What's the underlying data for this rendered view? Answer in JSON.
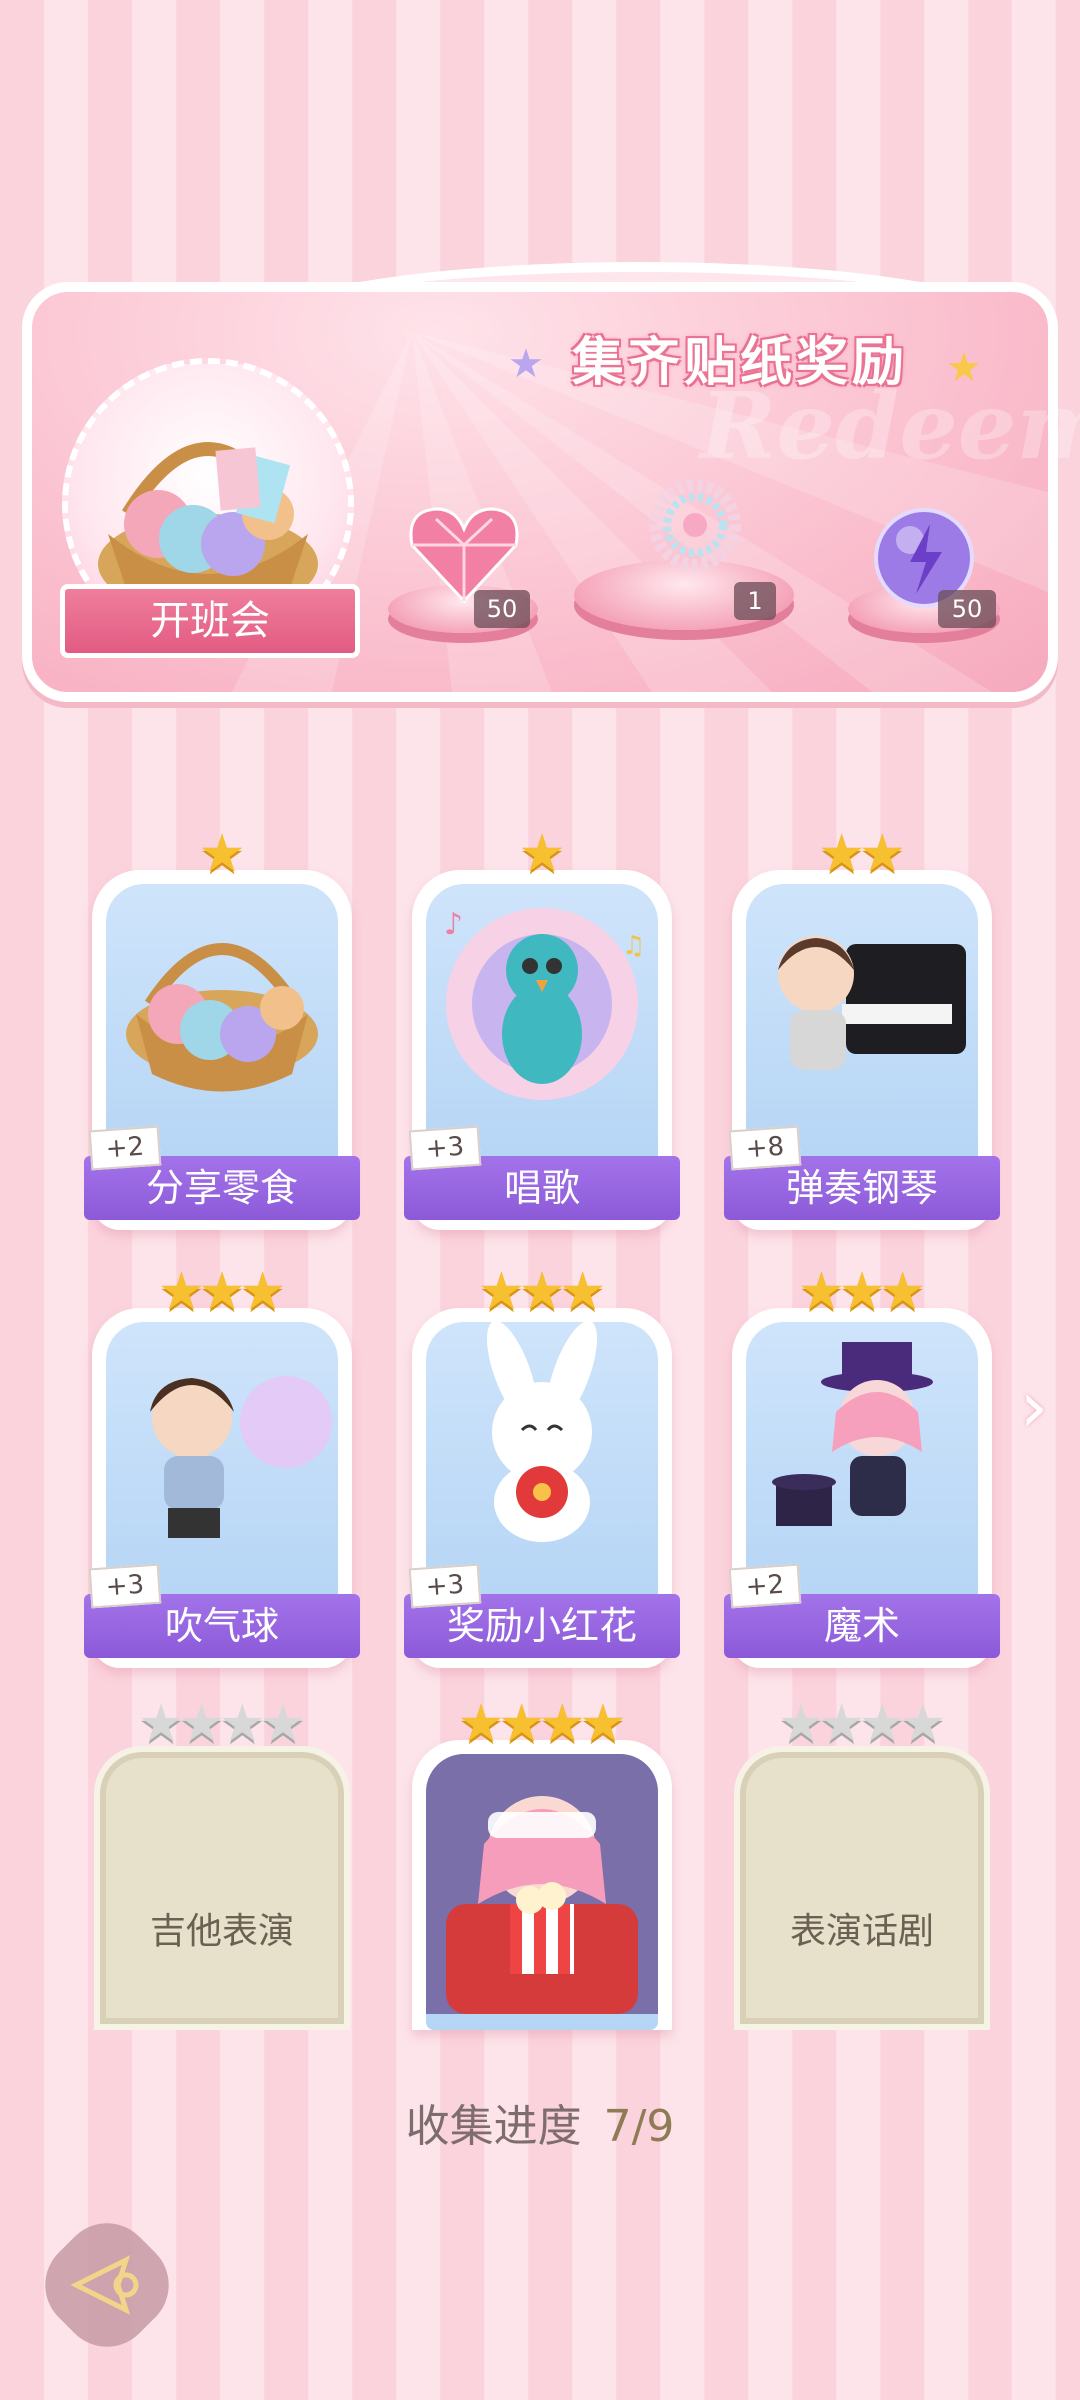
{
  "banner": {
    "title": "集齐贴纸奖励",
    "watermark": "Redeem",
    "event_name": "开班会",
    "rewards": [
      {
        "icon": "pink-heart-gem-icon",
        "count": "50"
      },
      {
        "icon": "pearl-bracelet-icon",
        "count": "1"
      },
      {
        "icon": "purple-energy-orb-icon",
        "count": "50"
      }
    ]
  },
  "stickers": [
    {
      "name": "分享零食",
      "bonus": "+2",
      "stars": 1,
      "unlocked": true,
      "icon": "snack-basket-icon"
    },
    {
      "name": "唱歌",
      "bonus": "+3",
      "stars": 1,
      "unlocked": true,
      "icon": "singing-peacock-icon"
    },
    {
      "name": "弹奏钢琴",
      "bonus": "+8",
      "stars": 2,
      "unlocked": true,
      "icon": "piano-boy-icon"
    },
    {
      "name": "吹气球",
      "bonus": "+3",
      "stars": 3,
      "unlocked": true,
      "icon": "balloon-boy-icon"
    },
    {
      "name": "奖励小红花",
      "bonus": "+3",
      "stars": 3,
      "unlocked": true,
      "icon": "bunny-red-flower-icon"
    },
    {
      "name": "魔术",
      "bonus": "+2",
      "stars": 3,
      "unlocked": true,
      "icon": "magician-girl-icon"
    },
    {
      "name": "吉他表演",
      "stars": 4,
      "unlocked": false,
      "icon": "locked-card-icon"
    },
    {
      "name": "",
      "stars": 4,
      "unlocked": true,
      "icon": "popcorn-girl-icon"
    },
    {
      "name": "表演话剧",
      "stars": 4,
      "unlocked": false,
      "icon": "locked-card-icon"
    }
  ],
  "progress": {
    "label": "收集进度",
    "value": "7/9"
  },
  "colors": {
    "accent_pink": "#e25b82",
    "ribbon_purple": "#9664e0",
    "star_gold": "#f7c030"
  }
}
